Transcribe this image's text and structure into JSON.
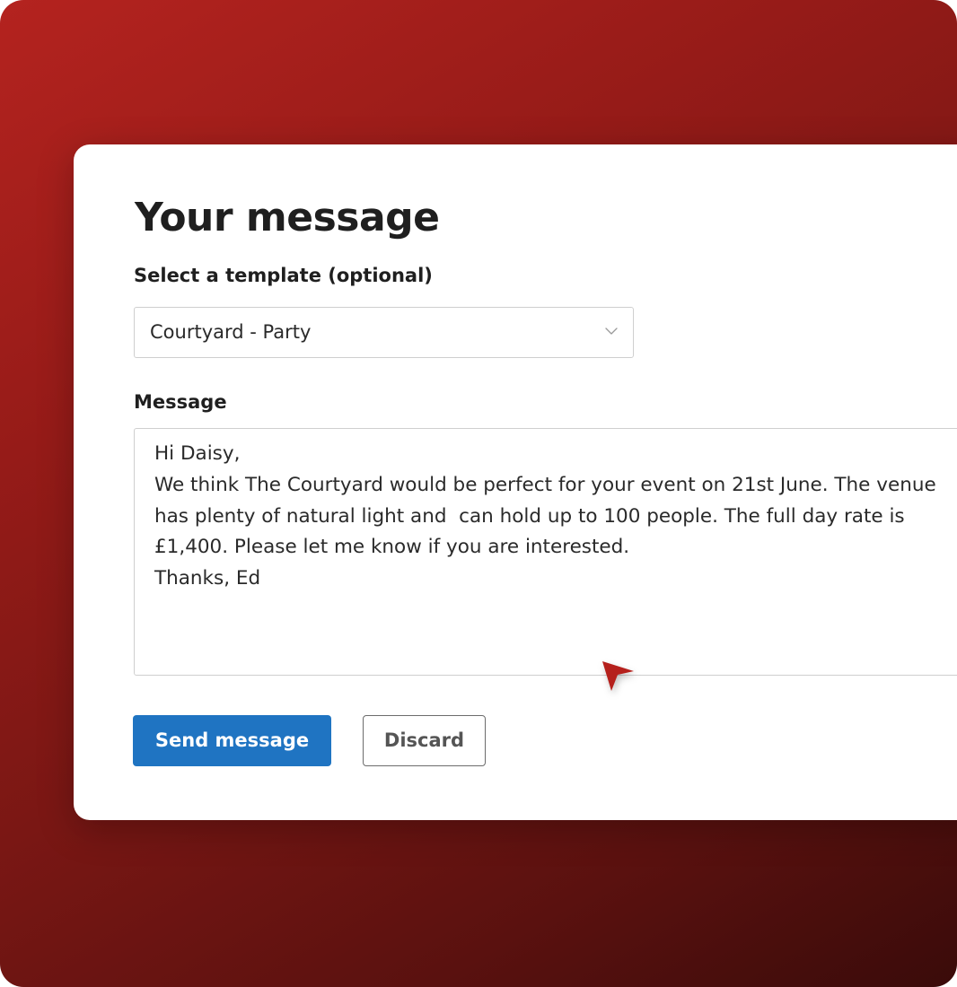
{
  "form": {
    "title": "Your message",
    "template_label": "Select a template (optional)",
    "template_selected": "Courtyard - Party",
    "message_label": "Message",
    "message_lines": [
      "Hi Daisy,",
      "We think The Courtyard would be perfect for your event on 21st June. The venue",
      "has plenty of natural light and  can hold up to 100 people. The full day rate is",
      "£1,400. Please let me know if you are interested.",
      "Thanks, Ed"
    ],
    "send_label": "Send message",
    "discard_label": "Discard"
  },
  "icons": {
    "select_chevron": "chevron-down-icon",
    "pointer": "cursor-arrow-icon"
  },
  "colors": {
    "background_gradient_start": "#b4231f",
    "background_gradient_end": "#3a0b0a",
    "card": "#ffffff",
    "primary_button": "#1f74c2",
    "text": "#1f1f1f",
    "border": "#cfcfcf",
    "cursor": "#b5201c"
  }
}
